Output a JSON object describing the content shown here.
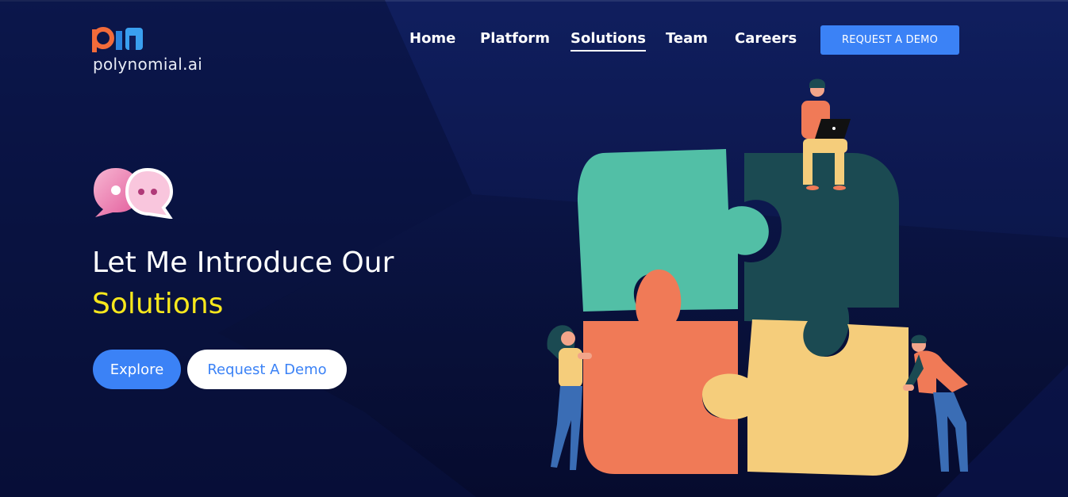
{
  "brand": {
    "name": "polynomial.ai",
    "mark_colors": [
      "#f26b3a",
      "#3aa0f0"
    ]
  },
  "nav": {
    "items": [
      {
        "label": "Home",
        "active": false
      },
      {
        "label": "Platform",
        "active": false
      },
      {
        "label": "Solutions",
        "active": true
      },
      {
        "label": "Team",
        "active": false
      },
      {
        "label": "Careers",
        "active": false
      }
    ],
    "cta": "REQUEST A DEMO"
  },
  "hero": {
    "line1": "Let Me Introduce Our",
    "line2": "Solutions",
    "explore_label": "Explore",
    "demo_label": "Request A Demo",
    "icon": "chat-bubbles-icon"
  },
  "colors": {
    "accent": "#3b82f6",
    "highlight": "#f7e71c",
    "puzzle_teal": "#52bfa6",
    "puzzle_dark": "#1b4a52",
    "puzzle_orange": "#f07a57",
    "puzzle_yellow": "#f5cd7b"
  },
  "illustration": {
    "name": "puzzle-team-illustration"
  }
}
